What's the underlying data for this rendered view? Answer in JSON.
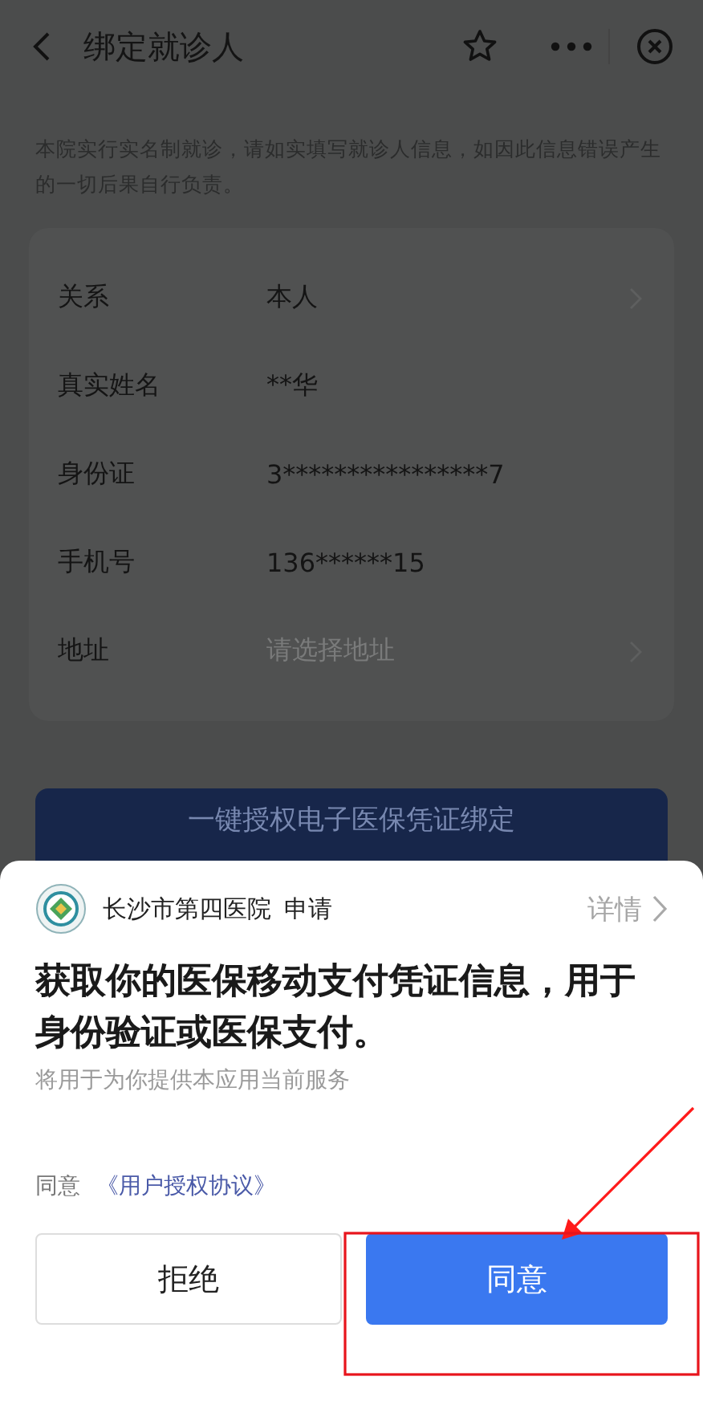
{
  "nav": {
    "title": "绑定就诊人"
  },
  "notice": "本院实行实名制就诊，请如实填写就诊人信息，如因此信息错误产生的一切后果自行负责。",
  "form": [
    {
      "label": "关系",
      "kind": "select",
      "value": "本人"
    },
    {
      "label": "真实姓名",
      "kind": "text",
      "value": "**华"
    },
    {
      "label": "身份证",
      "kind": "text",
      "value": "3****************7"
    },
    {
      "label": "手机号",
      "kind": "text",
      "value": "136******15"
    },
    {
      "label": "地址",
      "kind": "select",
      "placeholder": "请选择地址"
    }
  ],
  "bind_button": "一键授权电子医保凭证绑定",
  "sheet": {
    "app_name": "长沙市第四医院",
    "request": "申请",
    "details": "详情",
    "title": "获取你的医保移动支付凭证信息，用于身份验证或医保支付。",
    "subtitle": "将用于为你提供本应用当前服务",
    "agree_prefix": "同意",
    "agreement_link": "《用户授权协议》",
    "buttons": [
      {
        "label": "拒绝",
        "kind": "secondary"
      },
      {
        "label": "同意",
        "kind": "primary"
      }
    ]
  }
}
